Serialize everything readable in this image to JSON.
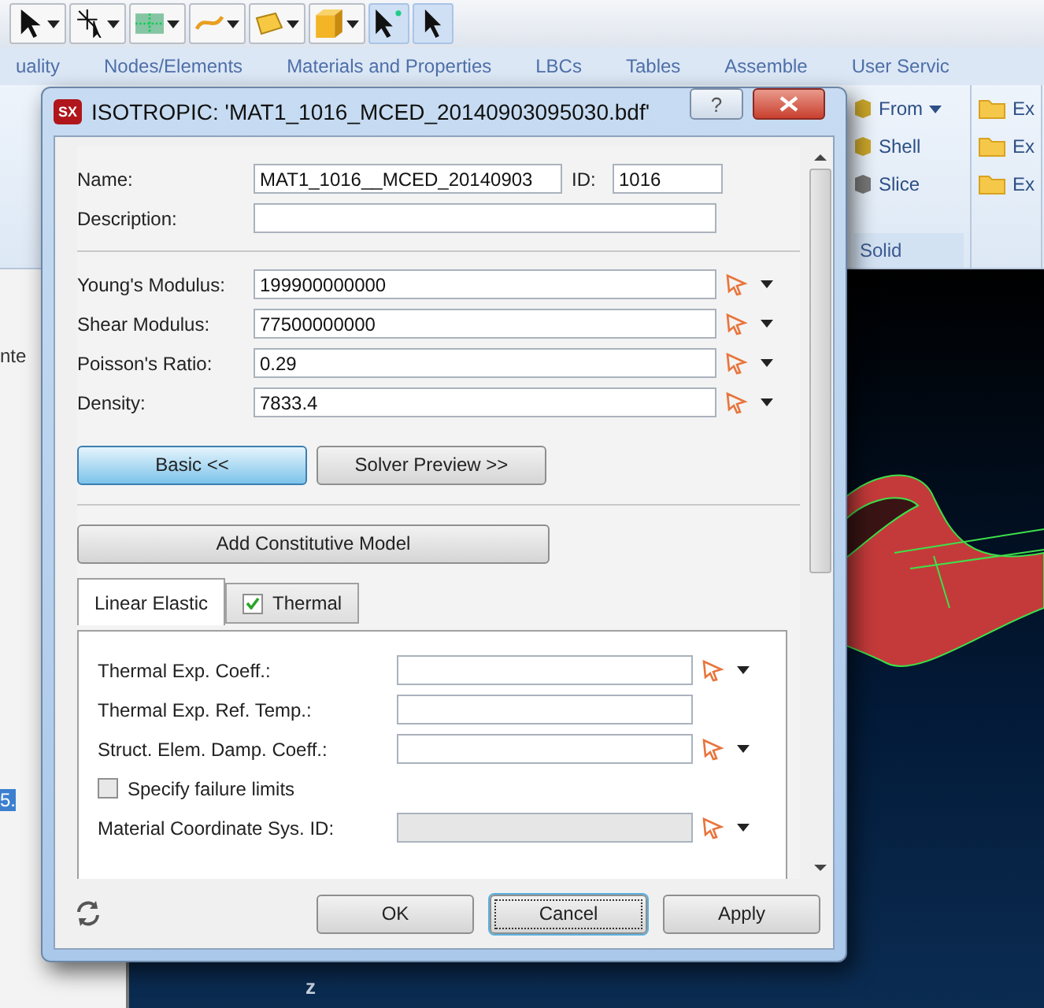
{
  "ribbon_tabs": [
    "uality",
    "Nodes/Elements",
    "Materials and Properties",
    "LBCs",
    "Tables",
    "Assemble",
    "User Servic"
  ],
  "ribbon": {
    "groups": [
      {
        "title": "Solid",
        "items": [
          {
            "label": "From",
            "dropdown": true
          },
          {
            "label": "Shell",
            "dropdown": false
          },
          {
            "label": "Slice",
            "dropdown": false
          }
        ]
      },
      {
        "items": [
          {
            "label": "Ex"
          },
          {
            "label": "Ex"
          },
          {
            "label": "Ex"
          }
        ]
      }
    ]
  },
  "side_fragments": [
    "nte",
    "5."
  ],
  "viewport": {
    "axis_label": "z"
  },
  "dialog": {
    "icon_text": "SX",
    "title": "ISOTROPIC: 'MAT1_1016_MCED_20140903095030.bdf'",
    "help": "?",
    "name": {
      "label": "Name:",
      "value": "MAT1_1016__MCED_20140903"
    },
    "id": {
      "label": "ID:",
      "value": "1016"
    },
    "description": {
      "label": "Description:"
    },
    "properties": [
      {
        "label": "Young's Modulus:",
        "value": "199900000000"
      },
      {
        "label": "Shear Modulus:",
        "value": "77500000000"
      },
      {
        "label": "Poisson's Ratio:",
        "value": "0.29"
      },
      {
        "label": "Density:",
        "value": "7833.4"
      }
    ],
    "mode_buttons": [
      {
        "label": "Basic <<",
        "selected": true
      },
      {
        "label": "Solver Preview >>",
        "selected": false
      }
    ],
    "add_model_button": "Add Constitutive Model",
    "tabs": [
      {
        "label": "Linear Elastic",
        "selected": true,
        "kind": "plain"
      },
      {
        "label": "Thermal",
        "selected": false,
        "kind": "checkbox",
        "checked": true
      }
    ],
    "tab_fields": [
      {
        "kind": "field",
        "label": "Thermal Exp. Coeff.:",
        "picker": true,
        "disabled": false
      },
      {
        "kind": "field",
        "label": "Thermal Exp. Ref. Temp.:",
        "picker": false,
        "disabled": false
      },
      {
        "kind": "field",
        "label": "Struct. Elem. Damp. Coeff.:",
        "picker": true,
        "disabled": false
      },
      {
        "kind": "checkbox",
        "label": "Specify failure limits",
        "checked": false
      },
      {
        "kind": "field",
        "label": "Material Coordinate Sys. ID:",
        "picker": true,
        "disabled": true
      }
    ],
    "footer_buttons": [
      {
        "label": "OK",
        "focused": false
      },
      {
        "label": "Cancel",
        "focused": true
      },
      {
        "label": "Apply",
        "focused": false
      }
    ]
  }
}
